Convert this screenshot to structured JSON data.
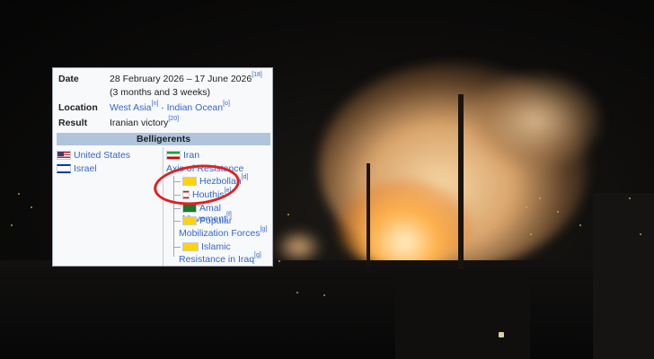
{
  "infobox": {
    "date_label": "Date",
    "date_value": "28 February 2026 – 17 June 2026",
    "date_ref": "[18]",
    "duration": "(3 months and 3 weeks)",
    "location_label": "Location",
    "location_a": "West Asia",
    "location_a_ref": "[n]",
    "location_sep": " · ",
    "location_b": "Indian Ocean",
    "location_b_ref": "[o]",
    "result_label": "Result",
    "result_value": "Iranian victory",
    "result_ref": "[20]",
    "belligerents_header": "Belligerents",
    "left_side": [
      {
        "flag": "us-flag-icon",
        "name": "United States"
      },
      {
        "flag": "israel-flag-icon",
        "name": "Israel"
      }
    ],
    "right_side": {
      "iran": "Iran",
      "axis": "Axis of Resistance",
      "members": {
        "hezbollah": "Hezbollah",
        "hezbollah_ref": "[d]",
        "houthis": "Houthis",
        "houthis_ref": "[e]",
        "amal": "Amal Movement",
        "amal_ref": "[f]",
        "pmf_1": "Popular",
        "pmf_2": "Mobilization Forces",
        "pmf_ref": "[g]",
        "irq_1": "Islamic",
        "irq_2": "Resistance in Iraq",
        "irq_ref": "[g]"
      }
    }
  },
  "colors": {
    "highlight_circle": "#e02020",
    "link": "#3366cc",
    "header_bg": "#b0c4de"
  }
}
